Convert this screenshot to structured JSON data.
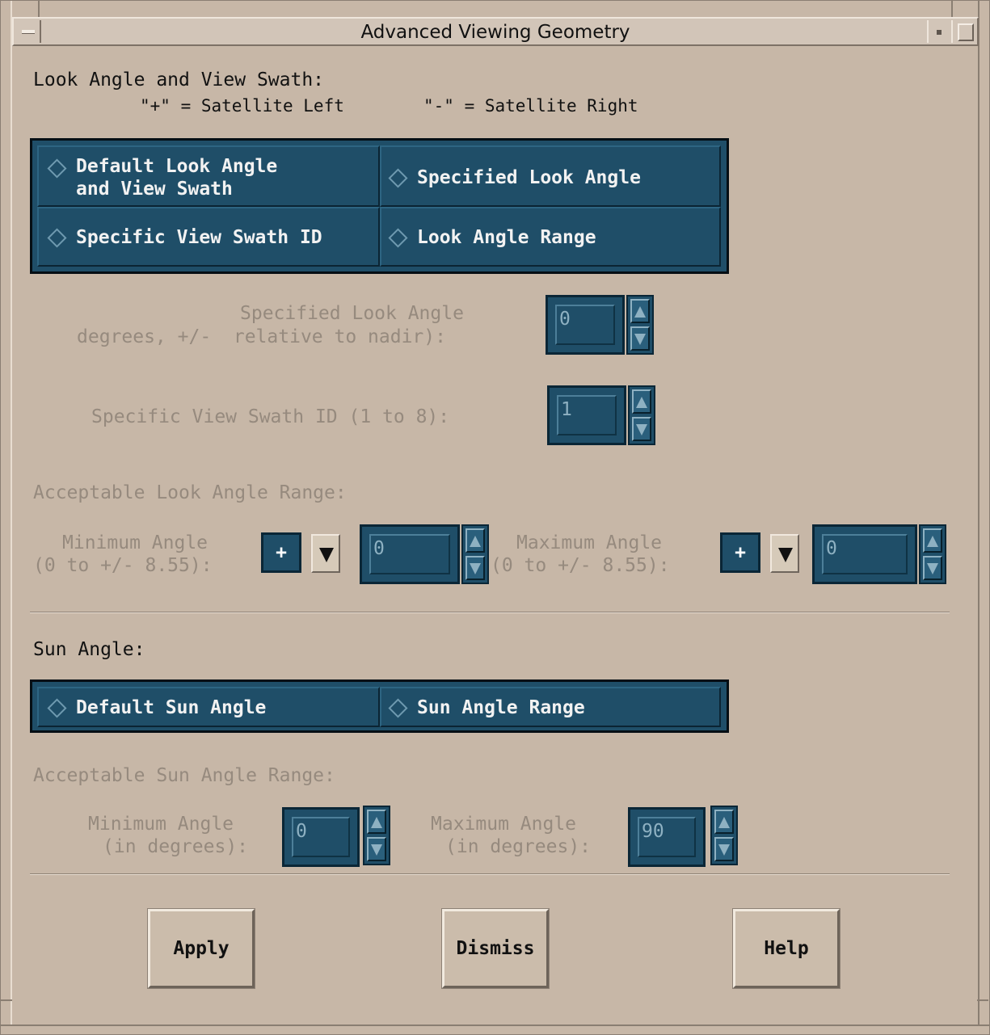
{
  "window": {
    "title": "Advanced Viewing Geometry"
  },
  "look": {
    "heading": "Look Angle and View Swath:",
    "note_left": "\"+\" = Satellite Left",
    "note_right": "\"-\" = Satellite Right",
    "options": [
      {
        "line1": "Default Look Angle",
        "line2": "and View Swath"
      },
      {
        "line1": "Specified Look Angle"
      },
      {
        "line1": "Specific View Swath ID"
      },
      {
        "line1": "Look Angle Range"
      }
    ],
    "specified_label_1": "Specified Look Angle",
    "specified_label_2": "degrees, +/-  relative to nadir):",
    "specified_value": "0",
    "swath_label": "Specific View Swath ID (1 to 8):",
    "swath_value": "1",
    "range_heading": "Acceptable Look Angle Range:",
    "min_label_1": "Minimum Angle",
    "min_label_2": "(0 to +/- 8.55):",
    "min_sign": "+",
    "min_value": "0",
    "max_label_1": "Maximum Angle",
    "max_label_2": "(0 to +/- 8.55):",
    "max_sign": "+",
    "max_value": "0"
  },
  "sun": {
    "heading": "Sun Angle:",
    "options": [
      {
        "line1": "Default Sun Angle"
      },
      {
        "line1": "Sun Angle Range"
      }
    ],
    "range_heading": "Acceptable Sun Angle Range:",
    "min_label_1": "Minimum Angle",
    "min_label_2": "(in degrees):",
    "min_value": "0",
    "max_label_1": "Maximum Angle",
    "max_label_2": "(in degrees):",
    "max_value": "90"
  },
  "buttons": {
    "apply": "Apply",
    "dismiss": "Dismiss",
    "help": "Help"
  },
  "colors": {
    "panel_bg": "#c7b7a7",
    "widget_blue": "#1f4e68",
    "disabled_text": "#968a7e"
  },
  "icons": {
    "window_menu": "window-menu-icon",
    "minimize": "minimize-icon",
    "maximize": "maximize-icon",
    "radio": "diamond-radio-icon",
    "spin_up": "arrow-up-icon",
    "spin_down": "arrow-down-icon",
    "dropdown": "triangle-down-icon"
  }
}
